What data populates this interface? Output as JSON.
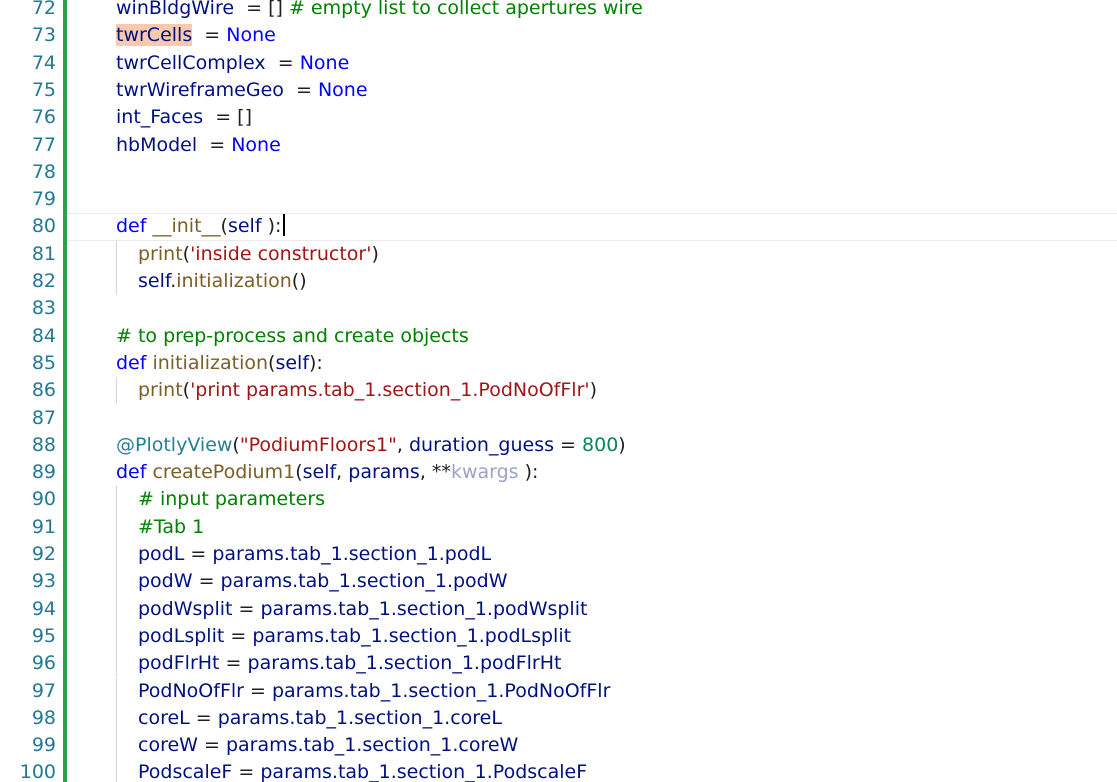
{
  "colors": {
    "gutter_change_bar": "#2ea043",
    "line_number": "#237893",
    "keyword": "#0000ff",
    "comment": "#008000",
    "string": "#a31515",
    "function": "#795e26",
    "highlight": "#f9c9ae"
  },
  "lines": [
    {
      "n": "72",
      "indent": 0,
      "tokens": [
        {
          "t": "winBldgWire",
          "c": "var"
        },
        {
          "t": "  = [] ",
          "c": "op"
        },
        {
          "t": "# empty list to collect apertures wire",
          "c": "com"
        }
      ]
    },
    {
      "n": "73",
      "indent": 0,
      "tokens": [
        {
          "t": "twrCells",
          "c": "var",
          "hl": true
        },
        {
          "t": "  = ",
          "c": "op"
        },
        {
          "t": "None",
          "c": "kw"
        }
      ]
    },
    {
      "n": "74",
      "indent": 0,
      "tokens": [
        {
          "t": "twrCellComplex",
          "c": "var"
        },
        {
          "t": "  = ",
          "c": "op"
        },
        {
          "t": "None",
          "c": "kw"
        }
      ]
    },
    {
      "n": "75",
      "indent": 0,
      "tokens": [
        {
          "t": "twrWireframeGeo",
          "c": "var"
        },
        {
          "t": "  = ",
          "c": "op"
        },
        {
          "t": "None",
          "c": "kw"
        }
      ]
    },
    {
      "n": "76",
      "indent": 0,
      "tokens": [
        {
          "t": "int_Faces",
          "c": "var"
        },
        {
          "t": "  = []",
          "c": "op"
        }
      ]
    },
    {
      "n": "77",
      "indent": 0,
      "tokens": [
        {
          "t": "hbModel",
          "c": "var"
        },
        {
          "t": "  = ",
          "c": "op"
        },
        {
          "t": "None",
          "c": "kw"
        }
      ]
    },
    {
      "n": "78",
      "indent": 0,
      "tokens": []
    },
    {
      "n": "79",
      "indent": 0,
      "tokens": []
    },
    {
      "n": "80",
      "indent": 0,
      "current": true,
      "caret": true,
      "tokens": [
        {
          "t": "def ",
          "c": "kw"
        },
        {
          "t": "__init__",
          "c": "fn"
        },
        {
          "t": "(",
          "c": "op"
        },
        {
          "t": "self",
          "c": "var"
        },
        {
          "t": " ):",
          "c": "op"
        }
      ]
    },
    {
      "n": "81",
      "indent": 1,
      "tokens": [
        {
          "t": "print",
          "c": "fn"
        },
        {
          "t": "(",
          "c": "op"
        },
        {
          "t": "'inside constructor'",
          "c": "str"
        },
        {
          "t": ")",
          "c": "op"
        }
      ]
    },
    {
      "n": "82",
      "indent": 1,
      "tokens": [
        {
          "t": "self",
          "c": "var"
        },
        {
          "t": ".",
          "c": "op"
        },
        {
          "t": "initialization",
          "c": "fn"
        },
        {
          "t": "()",
          "c": "op"
        }
      ]
    },
    {
      "n": "83",
      "indent": 0,
      "tokens": []
    },
    {
      "n": "84",
      "indent": 0,
      "tokens": [
        {
          "t": "# to prep-process and create objects",
          "c": "com"
        }
      ]
    },
    {
      "n": "85",
      "indent": 0,
      "tokens": [
        {
          "t": "def ",
          "c": "kw"
        },
        {
          "t": "initialization",
          "c": "fn"
        },
        {
          "t": "(",
          "c": "op"
        },
        {
          "t": "self",
          "c": "var"
        },
        {
          "t": "):",
          "c": "op"
        }
      ]
    },
    {
      "n": "86",
      "indent": 1,
      "tokens": [
        {
          "t": "print",
          "c": "fn"
        },
        {
          "t": "(",
          "c": "op"
        },
        {
          "t": "'print params.tab_1.section_1.PodNoOfFlr'",
          "c": "str"
        },
        {
          "t": ")",
          "c": "op"
        }
      ]
    },
    {
      "n": "87",
      "indent": 0,
      "tokens": []
    },
    {
      "n": "88",
      "indent": 0,
      "tokens": [
        {
          "t": "@PlotlyView",
          "c": "dec"
        },
        {
          "t": "(",
          "c": "op"
        },
        {
          "t": "\"PodiumFloors1\"",
          "c": "str"
        },
        {
          "t": ", ",
          "c": "op"
        },
        {
          "t": "duration_guess",
          "c": "var"
        },
        {
          "t": " = ",
          "c": "op"
        },
        {
          "t": "800",
          "c": "num"
        },
        {
          "t": ")",
          "c": "op"
        }
      ]
    },
    {
      "n": "89",
      "indent": 0,
      "tokens": [
        {
          "t": "def ",
          "c": "kw"
        },
        {
          "t": "createPodium1",
          "c": "fn"
        },
        {
          "t": "(",
          "c": "op"
        },
        {
          "t": "self",
          "c": "var"
        },
        {
          "t": ", ",
          "c": "op"
        },
        {
          "t": "params",
          "c": "var"
        },
        {
          "t": ", **",
          "c": "op"
        },
        {
          "t": "kwargs",
          "c": "dim"
        },
        {
          "t": " ):",
          "c": "op"
        }
      ]
    },
    {
      "n": "90",
      "indent": 1,
      "tokens": [
        {
          "t": "# input parameters",
          "c": "com"
        }
      ]
    },
    {
      "n": "91",
      "indent": 1,
      "tokens": [
        {
          "t": "#Tab 1",
          "c": "com"
        }
      ]
    },
    {
      "n": "92",
      "indent": 1,
      "tokens": [
        {
          "t": "podL",
          "c": "var"
        },
        {
          "t": " = ",
          "c": "op"
        },
        {
          "t": "params.tab_1.section_1.podL",
          "c": "var"
        }
      ]
    },
    {
      "n": "93",
      "indent": 1,
      "tokens": [
        {
          "t": "podW",
          "c": "var"
        },
        {
          "t": " = ",
          "c": "op"
        },
        {
          "t": "params.tab_1.section_1.podW",
          "c": "var"
        }
      ]
    },
    {
      "n": "94",
      "indent": 1,
      "tokens": [
        {
          "t": "podWsplit",
          "c": "var"
        },
        {
          "t": " = ",
          "c": "op"
        },
        {
          "t": "params.tab_1.section_1.podWsplit",
          "c": "var"
        }
      ]
    },
    {
      "n": "95",
      "indent": 1,
      "tokens": [
        {
          "t": "podLsplit",
          "c": "var"
        },
        {
          "t": " = ",
          "c": "op"
        },
        {
          "t": "params.tab_1.section_1.podLsplit",
          "c": "var"
        }
      ]
    },
    {
      "n": "96",
      "indent": 1,
      "tokens": [
        {
          "t": "podFlrHt",
          "c": "var"
        },
        {
          "t": " = ",
          "c": "op"
        },
        {
          "t": "params.tab_1.section_1.podFlrHt",
          "c": "var"
        }
      ]
    },
    {
      "n": "97",
      "indent": 1,
      "tokens": [
        {
          "t": "PodNoOfFlr",
          "c": "var"
        },
        {
          "t": " = ",
          "c": "op"
        },
        {
          "t": "params.tab_1.section_1.PodNoOfFlr",
          "c": "var"
        }
      ]
    },
    {
      "n": "98",
      "indent": 1,
      "tokens": [
        {
          "t": "coreL",
          "c": "var"
        },
        {
          "t": " = ",
          "c": "op"
        },
        {
          "t": "params.tab_1.section_1.coreL",
          "c": "var"
        }
      ]
    },
    {
      "n": "99",
      "indent": 1,
      "tokens": [
        {
          "t": "coreW",
          "c": "var"
        },
        {
          "t": " = ",
          "c": "op"
        },
        {
          "t": "params.tab_1.section_1.coreW",
          "c": "var"
        }
      ]
    },
    {
      "n": "100",
      "indent": 1,
      "tokens": [
        {
          "t": "PodscaleF",
          "c": "var"
        },
        {
          "t": " = ",
          "c": "op"
        },
        {
          "t": "params.tab_1.section_1.PodscaleF",
          "c": "var"
        }
      ]
    }
  ]
}
